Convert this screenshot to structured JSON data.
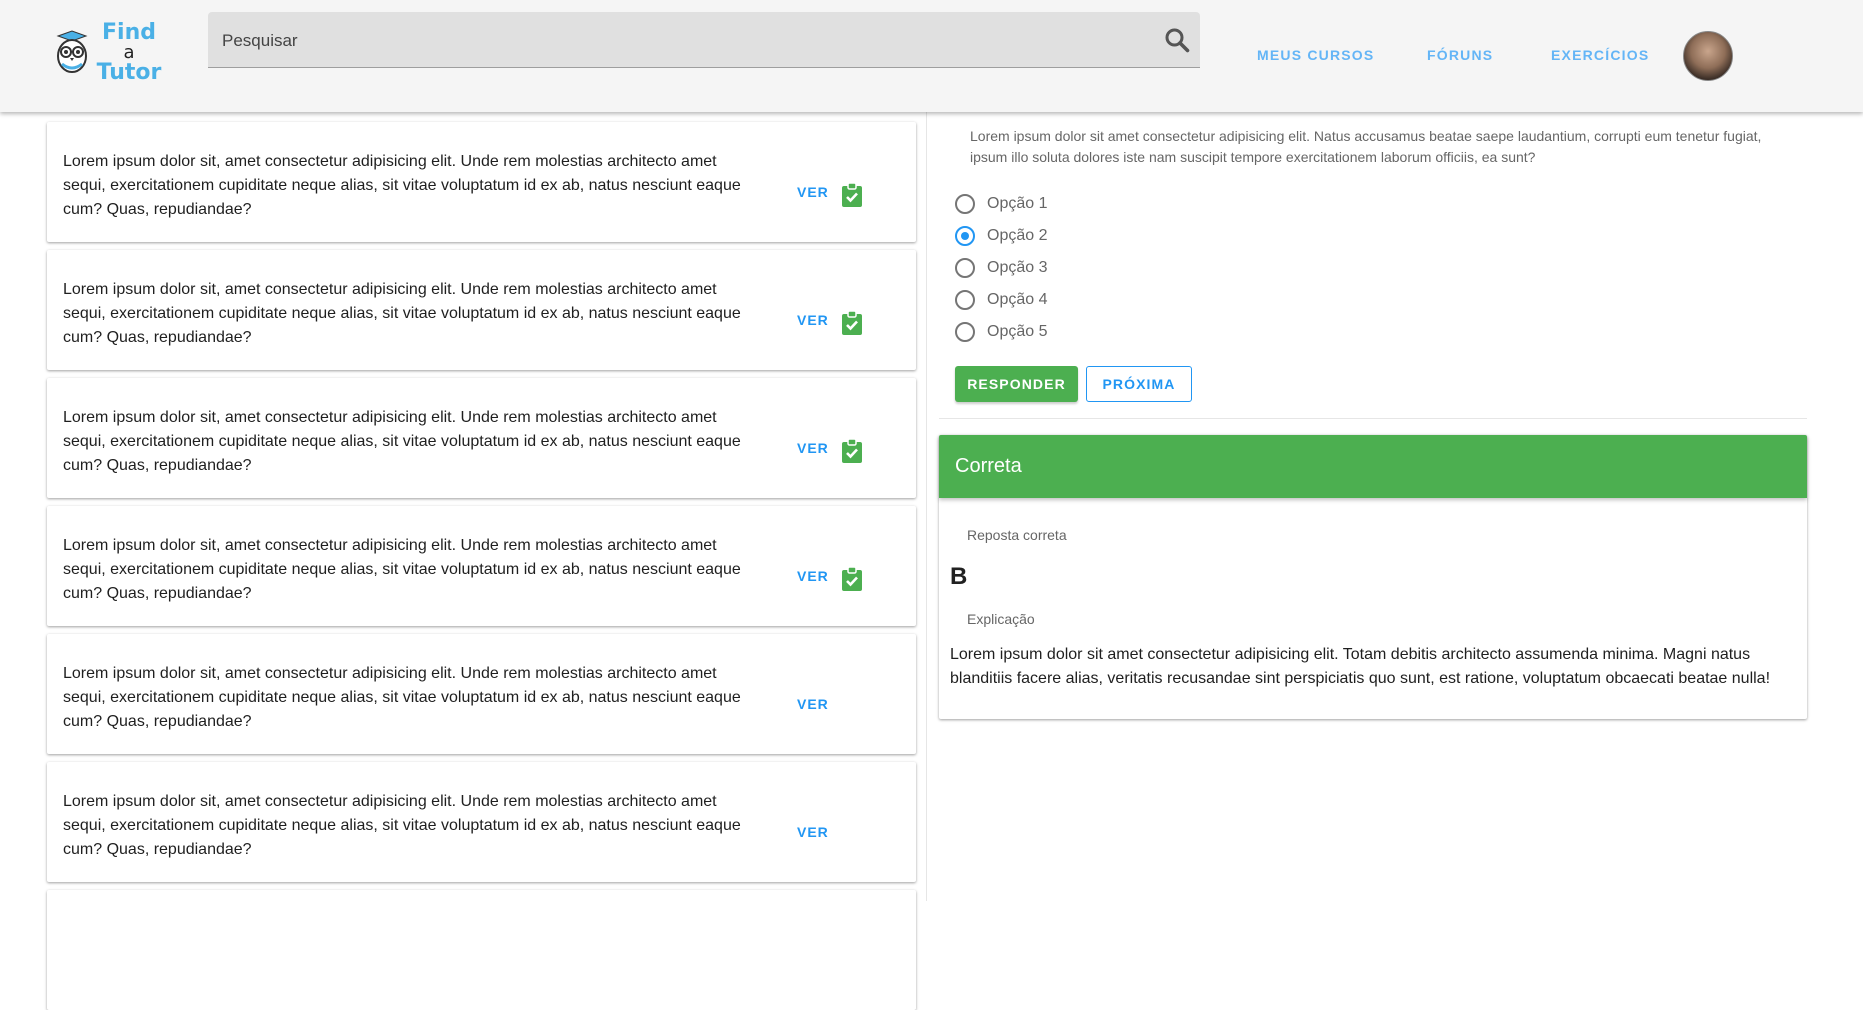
{
  "header": {
    "logo": {
      "line1": "Find",
      "line2": "a",
      "line3": "Tutor"
    },
    "search": {
      "placeholder": "Pesquisar"
    },
    "nav": [
      {
        "label": "MEUS CURSOS"
      },
      {
        "label": "FÓRUNS"
      },
      {
        "label": "EXERCÍCIOS"
      }
    ]
  },
  "exercises": [
    {
      "text": "Lorem ipsum dolor sit, amet consectetur adipisicing elit. Unde rem molestias architecto amet sequi, exercitationem cupiditate neque alias, sit vitae voluptatum id ex ab, natus nesciunt eaque cum? Quas, repudiandae?",
      "action": "VER",
      "completed": true
    },
    {
      "text": "Lorem ipsum dolor sit, amet consectetur adipisicing elit. Unde rem molestias architecto amet sequi, exercitationem cupiditate neque alias, sit vitae voluptatum id ex ab, natus nesciunt eaque cum? Quas, repudiandae?",
      "action": "VER",
      "completed": true
    },
    {
      "text": "Lorem ipsum dolor sit, amet consectetur adipisicing elit. Unde rem molestias architecto amet sequi, exercitationem cupiditate neque alias, sit vitae voluptatum id ex ab, natus nesciunt eaque cum? Quas, repudiandae?",
      "action": "VER",
      "completed": true
    },
    {
      "text": "Lorem ipsum dolor sit, amet consectetur adipisicing elit. Unde rem molestias architecto amet sequi, exercitationem cupiditate neque alias, sit vitae voluptatum id ex ab, natus nesciunt eaque cum? Quas, repudiandae?",
      "action": "VER",
      "completed": true
    },
    {
      "text": "Lorem ipsum dolor sit, amet consectetur adipisicing elit. Unde rem molestias architecto amet sequi, exercitationem cupiditate neque alias, sit vitae voluptatum id ex ab, natus nesciunt eaque cum? Quas, repudiandae?",
      "action": "VER",
      "completed": false
    },
    {
      "text": "Lorem ipsum dolor sit, amet consectetur adipisicing elit. Unde rem molestias architecto amet sequi, exercitationem cupiditate neque alias, sit vitae voluptatum id ex ab, natus nesciunt eaque cum? Quas, repudiandae?",
      "action": "VER",
      "completed": false
    }
  ],
  "question": {
    "text": "Lorem ipsum dolor sit amet consectetur adipisicing elit. Natus accusamus beatae saepe laudantium, corrupti eum tenetur fugiat, ipsum illo soluta dolores iste nam suscipit tempore exercitationem laborum officiis, ea sunt?",
    "options": [
      "Opção 1",
      "Opção 2",
      "Opção 3",
      "Opção 4",
      "Opção 5"
    ],
    "selected_index": 1,
    "respond_label": "RESPONDER",
    "next_label": "PRÓXIMA"
  },
  "result": {
    "status": "Correta",
    "correct_label": "Reposta correta",
    "correct_answer": "B",
    "explanation_label": "Explicação",
    "explanation": "Lorem ipsum dolor sit amet consectetur adipisicing elit. Totam debitis architecto assumenda minima. Magni natus blanditiis facere alias, veritatis recusandae sint perspiciatis quo sunt, est ratione, voluptatum obcaecati beatae nulla!"
  },
  "colors": {
    "primary": "#2196f3",
    "success": "#4caf50",
    "nav_link": "#64b5f6",
    "logo": "#4ab0e6"
  },
  "icons": {
    "search": "search-icon",
    "completed": "clipboard-check-icon",
    "logo": "owl-logo-icon"
  }
}
